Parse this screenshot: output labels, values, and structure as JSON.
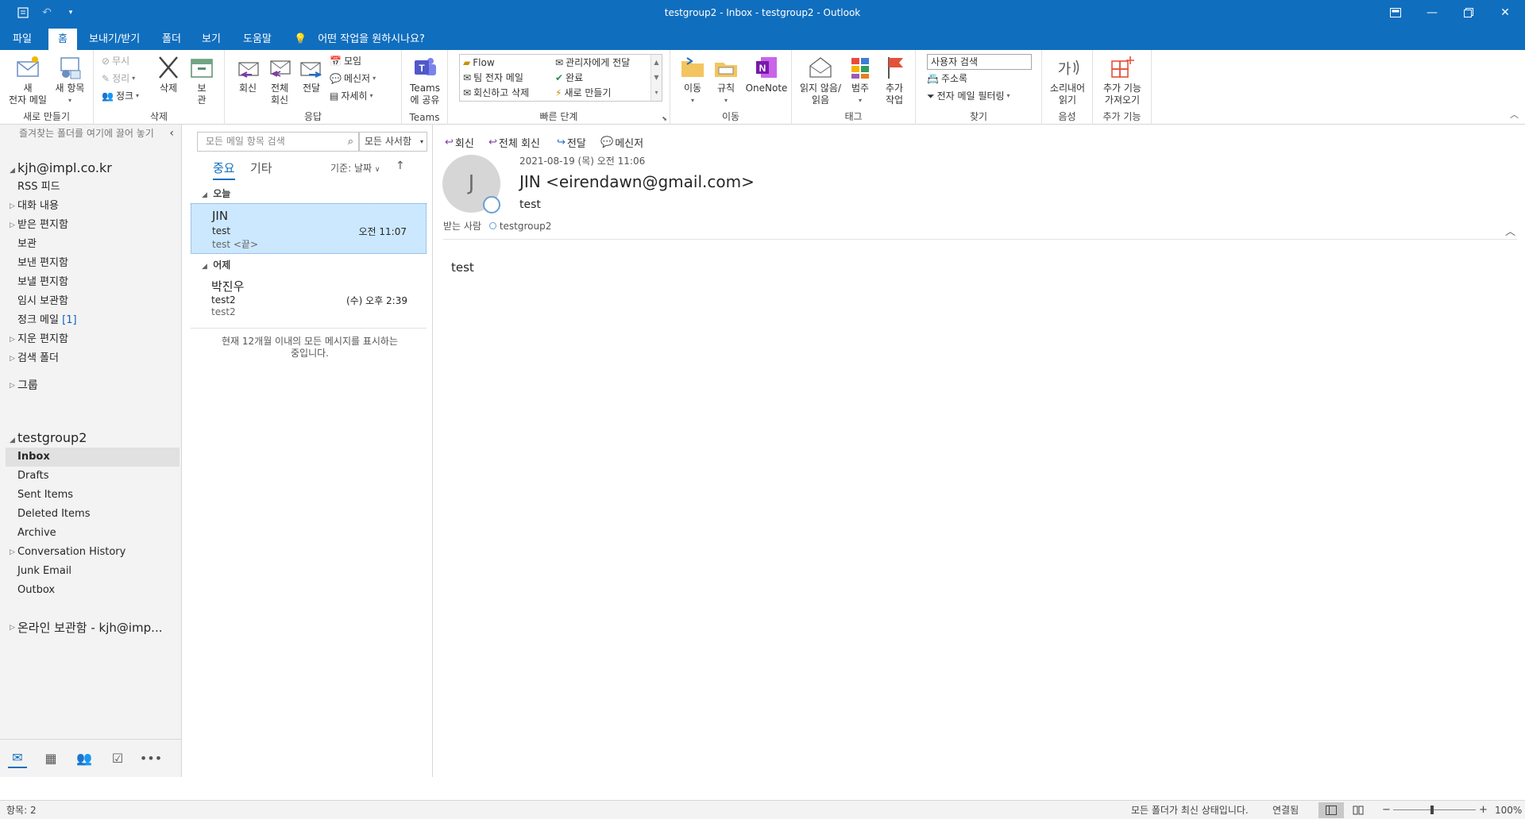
{
  "window": {
    "title": "testgroup2 - Inbox - testgroup2  -  Outlook",
    "controls": [
      "restore-down",
      "minimize",
      "maximize",
      "close"
    ]
  },
  "menu": {
    "tabs": [
      "파일",
      "홈",
      "보내기/받기",
      "폴더",
      "보기",
      "도움말"
    ],
    "active_tab": "홈",
    "tell_me": "어떤 작업을 원하시나요?"
  },
  "ribbon": {
    "new": {
      "new_email": "새\n전자 메일",
      "new_items": "새 항목",
      "group": "새로 만들기"
    },
    "delete": {
      "ignore": "무시",
      "cleanup": "정리",
      "junk": "정크",
      "delete": "삭제",
      "archive": "보\n관",
      "group": "삭제"
    },
    "respond": {
      "reply": "회신",
      "reply_all": "전체\n회신",
      "forward": "전달",
      "meeting": "모임",
      "im": "메신저",
      "more": "자세히",
      "group": "응답"
    },
    "teams": {
      "share": "Teams\n에 공유",
      "group": "Teams"
    },
    "quick_steps": {
      "items": [
        "Flow",
        "팀 전자 메일",
        "회신하고 삭제",
        "관리자에게 전달",
        "완료",
        "새로 만들기"
      ],
      "group": "빠른 단계"
    },
    "move": {
      "move": "이동",
      "rules": "규칙",
      "onenote": "OneNote",
      "group": "이동"
    },
    "tags": {
      "unread_read": "읽지 않음/\n읽음",
      "categorize": "범주",
      "followup": "추가\n작업",
      "group": "태그"
    },
    "find": {
      "search_people": "사용자 검색",
      "address_book": "주소록",
      "filter_email": "전자 메일 필터링",
      "group": "찾기"
    },
    "speech": {
      "read_aloud": "소리내어\n읽기",
      "group": "음성"
    },
    "addins": {
      "get_addins": "추가 기능\n가져오기",
      "group": "추가 기능"
    }
  },
  "nav": {
    "favorites_hint": "즐겨찾는 폴더를 여기에 끌어 놓기",
    "account1": {
      "name": "kjh@impl.co.kr",
      "folders": [
        "RSS 피드",
        "대화 내용",
        "받은 편지함",
        "보관",
        "보낸 편지함",
        "보낼 편지함",
        "임시 보관함",
        "정크 메일",
        "지운 편지함",
        "검색 폴더"
      ],
      "junk_count": "[1]"
    },
    "groups": "그룹",
    "account2": {
      "name": "testgroup2",
      "folders": [
        "Inbox",
        "Drafts",
        "Sent Items",
        "Deleted Items",
        "Archive",
        "Conversation History",
        "Junk Email",
        "Outbox"
      ]
    },
    "online_archive": "온라인 보관함 - kjh@imp..."
  },
  "list": {
    "search_placeholder": "모든 메일 항목 검색",
    "scope": "모든 사서함",
    "filter_tabs": [
      "중요",
      "기타"
    ],
    "sort_by": "기준: 날짜",
    "groups": [
      {
        "label": "오늘",
        "messages": [
          {
            "from": "JIN",
            "subject": "test",
            "preview": "test <끝>",
            "time": "오전 11:07",
            "selected": true
          }
        ]
      },
      {
        "label": "어제",
        "messages": [
          {
            "from": "박진우",
            "subject": "test2",
            "preview": "test2",
            "time": "(수) 오후 2:39",
            "selected": false
          }
        ]
      }
    ],
    "footer": "현재 12개월 이내의 모든 메시지를 표시하는\n중입니다."
  },
  "reading": {
    "actions": [
      "회신",
      "전체 회신",
      "전달",
      "메신저"
    ],
    "date": "2021-08-19 (목) 오전 11:06",
    "avatar_initial": "J",
    "from": "JIN <eirendawn@gmail.com>",
    "subject": "test",
    "to_label": "받는 사람",
    "to": "testgroup2",
    "body": "test"
  },
  "status": {
    "items_count": "항목: 2",
    "sync": "모든 폴더가 최신 상태입니다.",
    "connection": "연결됨",
    "zoom": "100%"
  }
}
